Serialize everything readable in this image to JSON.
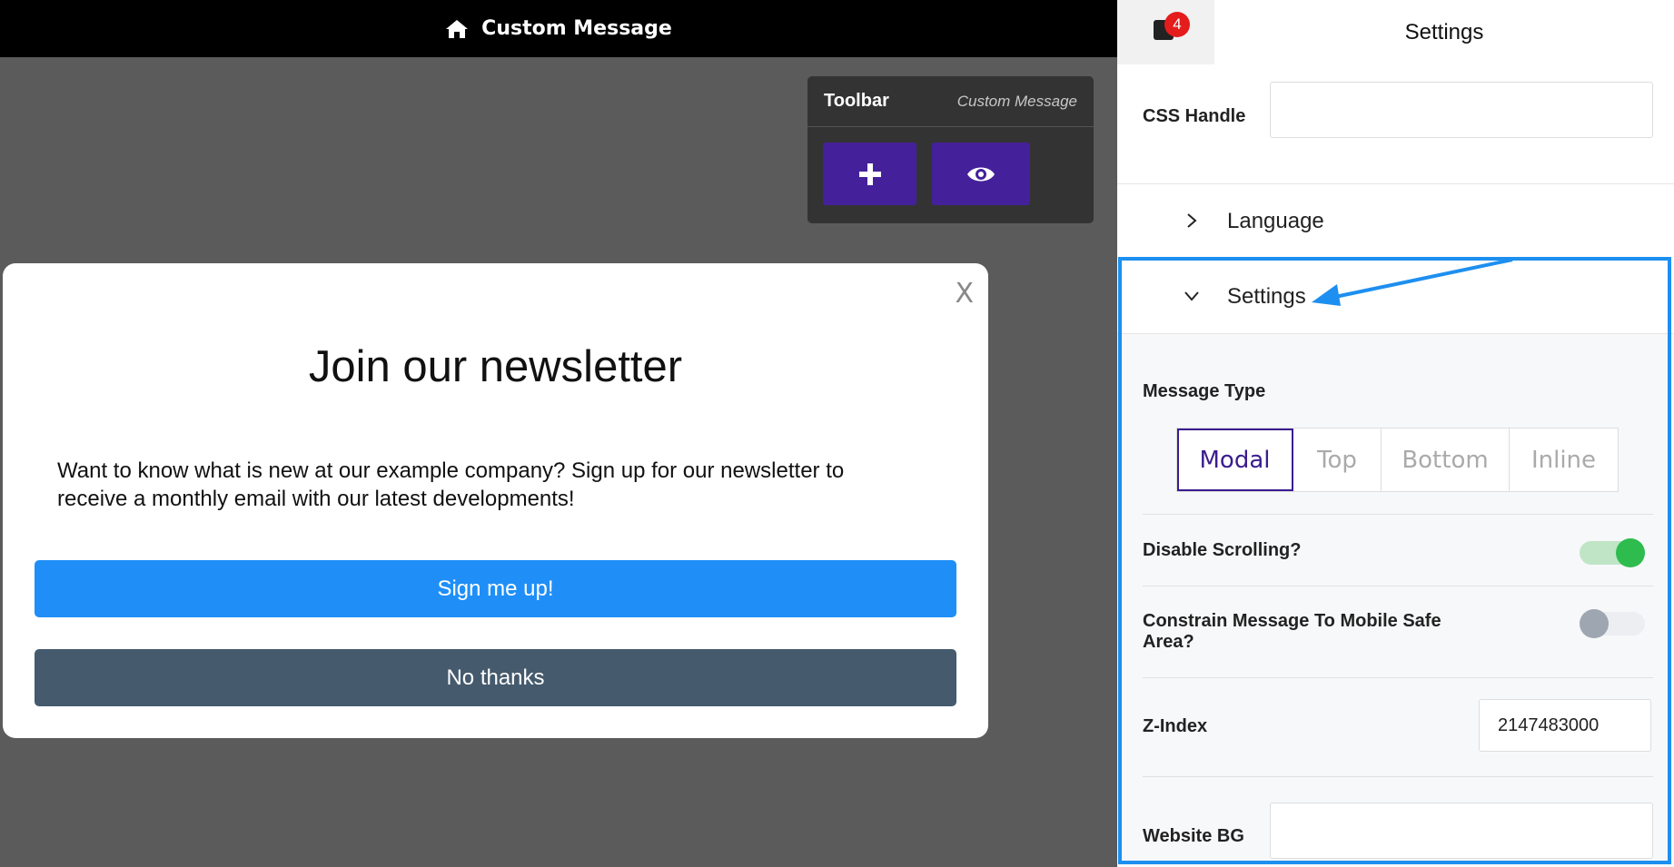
{
  "topbar": {
    "title": "Custom Message",
    "icon": "home-icon"
  },
  "toolbar": {
    "title": "Toolbar",
    "subtitle": "Custom Message",
    "add_icon": "plus-icon",
    "preview_icon": "eye-icon"
  },
  "modal": {
    "close_label": "X",
    "heading": "Join our newsletter",
    "body": "Want to know what is new at our example company? Sign up for our newsletter to receive a monthly email with our latest developments!",
    "primary_label": "Sign me up!",
    "secondary_label": "No thanks",
    "primary_color": "#1f8ff7",
    "secondary_color": "#455a6d"
  },
  "panel": {
    "notification_count": "4",
    "tab_title": "Settings",
    "css_handle_label": "CSS Handle",
    "css_handle_value": "",
    "language_label": "Language",
    "settings_label": "Settings",
    "message_type_label": "Message Type",
    "message_types": [
      "Modal",
      "Top",
      "Bottom",
      "Inline"
    ],
    "message_type_selected": "Modal",
    "disable_scrolling_label": "Disable Scrolling?",
    "disable_scrolling_on": true,
    "constrain_label": "Constrain Message To Mobile Safe Area?",
    "constrain_on": false,
    "zindex_label": "Z-Index",
    "zindex_value": "2147483000",
    "website_bg_label": "Website BG",
    "website_bg_value": "",
    "accent_color": "#3a1c8f",
    "highlight_color": "#1d8ff0"
  }
}
